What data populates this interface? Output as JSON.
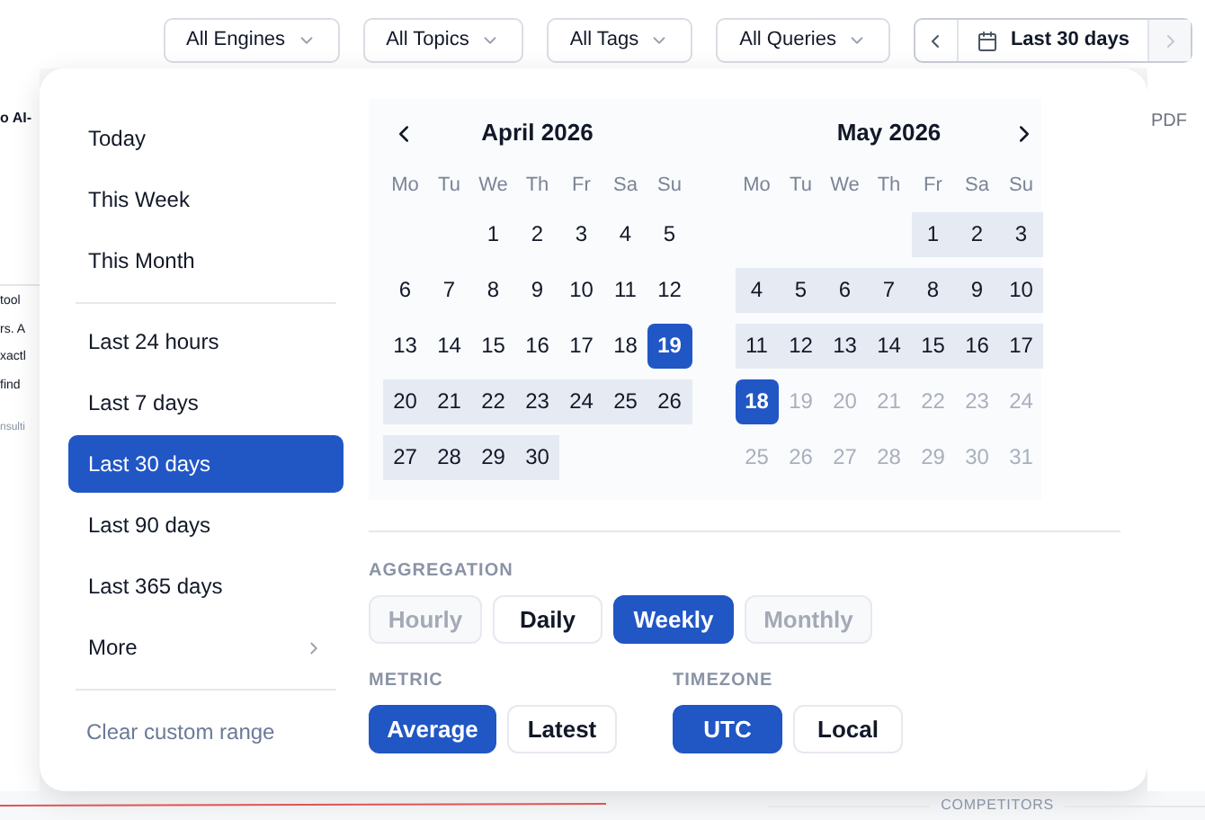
{
  "filters": [
    {
      "label": "All Engines"
    },
    {
      "label": "All Topics"
    },
    {
      "label": "All Tags"
    },
    {
      "label": "All Queries"
    }
  ],
  "date_button": {
    "label": "Last 30 days",
    "next_disabled": true
  },
  "background": {
    "heading": "o AI-",
    "body_lines": [
      "tool",
      "rs. A",
      "xactl",
      "find"
    ],
    "tag": "nsulti",
    "export": "PDF",
    "section": "COMPETITORS"
  },
  "preset_groups": [
    [
      {
        "label": "Today",
        "selected": false,
        "submenu": false
      },
      {
        "label": "This Week",
        "selected": false,
        "submenu": false
      },
      {
        "label": "This Month",
        "selected": false,
        "submenu": false
      }
    ],
    [
      {
        "label": "Last 24 hours",
        "selected": false,
        "submenu": false
      },
      {
        "label": "Last 7 days",
        "selected": false,
        "submenu": false
      },
      {
        "label": "Last 30 days",
        "selected": true,
        "submenu": false
      },
      {
        "label": "Last 90 days",
        "selected": false,
        "submenu": false
      },
      {
        "label": "Last 365 days",
        "selected": false,
        "submenu": false
      },
      {
        "label": "More",
        "selected": false,
        "submenu": true
      }
    ]
  ],
  "clear_label": "Clear custom range",
  "months": [
    {
      "title": "April 2026",
      "weekdays": [
        "Mo",
        "Tu",
        "We",
        "Th",
        "Fr",
        "Sa",
        "Su"
      ],
      "weeks": [
        {
          "kind": "partial_start",
          "days": [
            {
              "d": "1",
              "kind": "normal"
            },
            {
              "d": "2",
              "kind": "normal"
            },
            {
              "d": "3",
              "kind": "normal"
            },
            {
              "d": "4",
              "kind": "normal"
            },
            {
              "d": "5",
              "kind": "normal"
            }
          ]
        },
        {
          "kind": "full",
          "days": [
            {
              "d": "6",
              "kind": "normal"
            },
            {
              "d": "7",
              "kind": "normal"
            },
            {
              "d": "8",
              "kind": "normal"
            },
            {
              "d": "9",
              "kind": "normal"
            },
            {
              "d": "10",
              "kind": "normal"
            },
            {
              "d": "11",
              "kind": "normal"
            },
            {
              "d": "12",
              "kind": "normal"
            }
          ]
        },
        {
          "kind": "full",
          "days": [
            {
              "d": "13",
              "kind": "normal"
            },
            {
              "d": "14",
              "kind": "normal"
            },
            {
              "d": "15",
              "kind": "normal"
            },
            {
              "d": "16",
              "kind": "normal"
            },
            {
              "d": "17",
              "kind": "normal"
            },
            {
              "d": "18",
              "kind": "normal"
            },
            {
              "d": "19",
              "kind": "selected"
            }
          ]
        },
        {
          "kind": "full",
          "days": [
            {
              "d": "20",
              "kind": "in_range"
            },
            {
              "d": "21",
              "kind": "in_range"
            },
            {
              "d": "22",
              "kind": "in_range"
            },
            {
              "d": "23",
              "kind": "in_range"
            },
            {
              "d": "24",
              "kind": "in_range"
            },
            {
              "d": "25",
              "kind": "in_range"
            },
            {
              "d": "26",
              "kind": "in_range"
            }
          ]
        },
        {
          "kind": "partial_end",
          "days": [
            {
              "d": "27",
              "kind": "in_range"
            },
            {
              "d": "28",
              "kind": "in_range"
            },
            {
              "d": "29",
              "kind": "in_range"
            },
            {
              "d": "30",
              "kind": "in_range"
            }
          ]
        }
      ]
    },
    {
      "title": "May 2026",
      "weekdays": [
        "Mo",
        "Tu",
        "We",
        "Th",
        "Fr",
        "Sa",
        "Su"
      ],
      "weeks": [
        {
          "kind": "partial_start",
          "days": [
            {
              "d": "1",
              "kind": "in_range"
            },
            {
              "d": "2",
              "kind": "in_range"
            },
            {
              "d": "3",
              "kind": "in_range"
            }
          ]
        },
        {
          "kind": "full",
          "days": [
            {
              "d": "4",
              "kind": "in_range"
            },
            {
              "d": "5",
              "kind": "in_range"
            },
            {
              "d": "6",
              "kind": "in_range"
            },
            {
              "d": "7",
              "kind": "in_range"
            },
            {
              "d": "8",
              "kind": "in_range"
            },
            {
              "d": "9",
              "kind": "in_range"
            },
            {
              "d": "10",
              "kind": "in_range"
            }
          ]
        },
        {
          "kind": "full",
          "days": [
            {
              "d": "11",
              "kind": "in_range"
            },
            {
              "d": "12",
              "kind": "in_range"
            },
            {
              "d": "13",
              "kind": "in_range"
            },
            {
              "d": "14",
              "kind": "in_range"
            },
            {
              "d": "15",
              "kind": "in_range"
            },
            {
              "d": "16",
              "kind": "in_range"
            },
            {
              "d": "17",
              "kind": "in_range"
            }
          ]
        },
        {
          "kind": "full",
          "days": [
            {
              "d": "18",
              "kind": "selected"
            },
            {
              "d": "19",
              "kind": "disabled"
            },
            {
              "d": "20",
              "kind": "disabled"
            },
            {
              "d": "21",
              "kind": "disabled"
            },
            {
              "d": "22",
              "kind": "disabled"
            },
            {
              "d": "23",
              "kind": "disabled"
            },
            {
              "d": "24",
              "kind": "disabled"
            }
          ]
        },
        {
          "kind": "full",
          "days": [
            {
              "d": "25",
              "kind": "disabled"
            },
            {
              "d": "26",
              "kind": "disabled"
            },
            {
              "d": "27",
              "kind": "disabled"
            },
            {
              "d": "28",
              "kind": "disabled"
            },
            {
              "d": "29",
              "kind": "disabled"
            },
            {
              "d": "30",
              "kind": "disabled"
            },
            {
              "d": "31",
              "kind": "disabled"
            }
          ]
        }
      ]
    }
  ],
  "aggregation": {
    "label": "AGGREGATION",
    "options": [
      {
        "label": "Hourly",
        "kind": "disabled"
      },
      {
        "label": "Daily",
        "kind": "normal"
      },
      {
        "label": "Weekly",
        "kind": "selected"
      },
      {
        "label": "Monthly",
        "kind": "disabled"
      }
    ]
  },
  "metric": {
    "label": "METRIC",
    "options": [
      {
        "label": "Average",
        "kind": "selected"
      },
      {
        "label": "Latest",
        "kind": "normal"
      }
    ]
  },
  "timezone": {
    "label": "TIMEZONE",
    "options": [
      {
        "label": "UTC",
        "kind": "selected"
      },
      {
        "label": "Local",
        "kind": "normal"
      }
    ]
  }
}
